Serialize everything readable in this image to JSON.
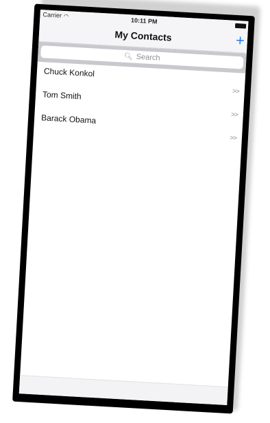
{
  "status": {
    "carrier": "Carrier",
    "wifi_icon": "wifi-icon",
    "time": "10:11 PM",
    "battery_icon": "battery-icon"
  },
  "nav": {
    "title": "My Contacts",
    "add_label": "+",
    "add_icon": "plus-icon"
  },
  "search": {
    "placeholder": "Search",
    "icon": "search-icon"
  },
  "contacts": [
    {
      "name": "Chuck Konkol",
      "disclosure": ">>"
    },
    {
      "name": "Tom Smith",
      "disclosure": ">>"
    },
    {
      "name": "Barack Obama",
      "disclosure": ">>"
    }
  ],
  "colors": {
    "accent": "#1e7cf6",
    "navbar_bg": "#f5f5f7",
    "search_bg": "#c8c8cd",
    "device_frame": "#000000"
  }
}
